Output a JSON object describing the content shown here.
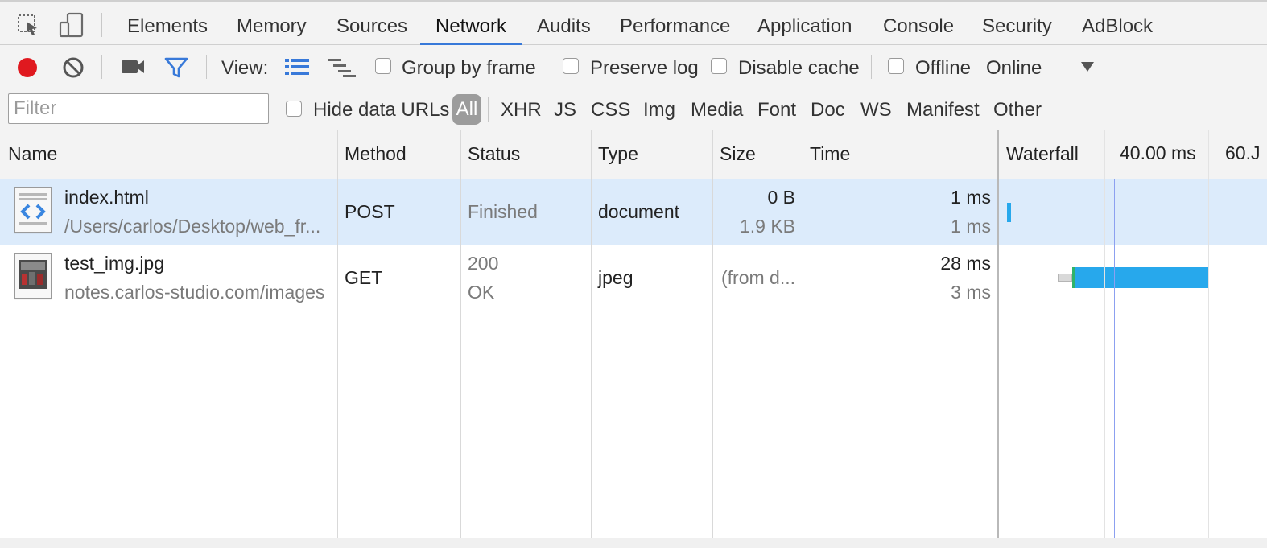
{
  "tabs": [
    "Elements",
    "Memory",
    "Sources",
    "Network",
    "Audits",
    "Performance",
    "Application",
    "Console",
    "Security",
    "AdBlock"
  ],
  "active_tab": "Network",
  "toolbar": {
    "view_label": "View:",
    "group_by_frame": "Group by frame",
    "preserve_log": "Preserve log",
    "disable_cache": "Disable cache",
    "offline": "Offline",
    "throttle": "Online"
  },
  "filterbar": {
    "placeholder": "Filter",
    "hide_data_urls": "Hide data URLs",
    "types": [
      "All",
      "XHR",
      "JS",
      "CSS",
      "Img",
      "Media",
      "Font",
      "Doc",
      "WS",
      "Manifest",
      "Other"
    ]
  },
  "columns": {
    "name": "Name",
    "method": "Method",
    "status": "Status",
    "type": "Type",
    "size": "Size",
    "time": "Time",
    "waterfall": "Waterfall",
    "tick1": "40.00 ms",
    "tick2": "60.J"
  },
  "requests": [
    {
      "name": "index.html",
      "path": "/Users/carlos/Desktop/web_fr...",
      "method": "POST",
      "status": "Finished",
      "status_text": "",
      "type": "document",
      "size": "0 B",
      "size2": "1.9 KB",
      "time": "1 ms",
      "latency": "1 ms",
      "icon": "html-file-icon"
    },
    {
      "name": "test_img.jpg",
      "path": "notes.carlos-studio.com/images",
      "method": "GET",
      "status": "200",
      "status_text": "OK",
      "type": "jpeg",
      "size": "(from d...",
      "size2": "",
      "time": "28 ms",
      "latency": "3 ms",
      "icon": "image-file-icon"
    }
  ],
  "colors": {
    "accent": "#3879d9",
    "record": "#e0191f",
    "row_selected": "#dcebfb",
    "waterfall_bar": "#27a8ec",
    "dom_loaded_line": "#8ca0f0",
    "load_line": "#e8454a"
  }
}
